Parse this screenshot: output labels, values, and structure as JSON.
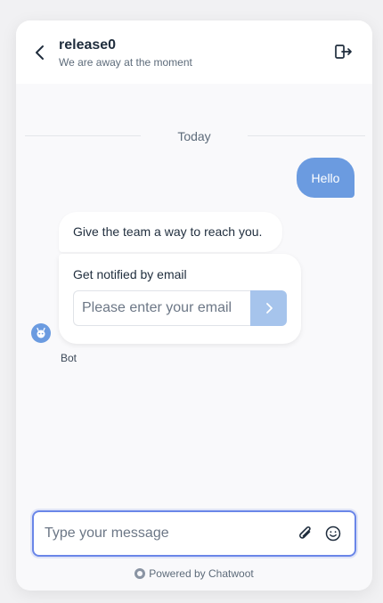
{
  "header": {
    "title": "release0",
    "subtitle": "We are away at the moment"
  },
  "conversation": {
    "date_label": "Today",
    "messages": [
      {
        "sender": "user",
        "text": "Hello"
      },
      {
        "sender": "bot",
        "text": "Give the team a way to reach you."
      }
    ],
    "email_card": {
      "label": "Get notified by email",
      "placeholder": "Please enter your email"
    },
    "bot_name": "Bot"
  },
  "composer": {
    "placeholder": "Type your message"
  },
  "branding": {
    "text": "Powered by Chatwoot"
  },
  "icons": {
    "back": "chevron-left-icon",
    "exit": "logout-icon",
    "submit": "chevron-right-icon",
    "attach": "paperclip-icon",
    "emoji": "smiley-icon",
    "avatar": "bot-icon"
  },
  "colors": {
    "accent": "#6b9be0",
    "submit": "#a6c4ec",
    "focus_border": "#6a86e8"
  }
}
